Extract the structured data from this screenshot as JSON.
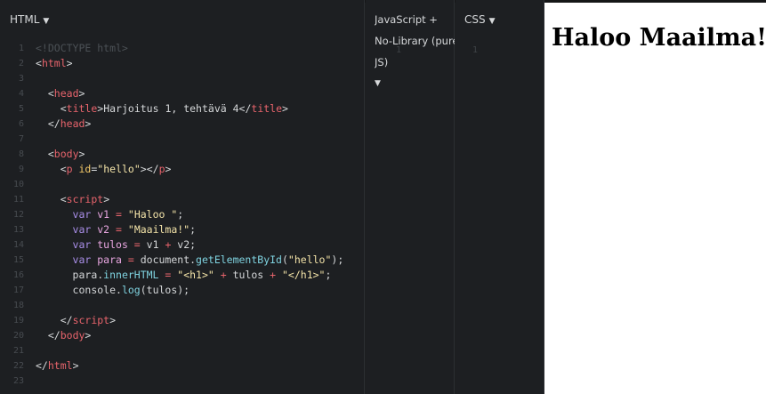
{
  "panels": {
    "html": {
      "label": "HTML",
      "caret": "▼"
    },
    "js": {
      "line1": "JavaScript +",
      "line2": "No-Library (pure",
      "line3": "JS)",
      "caret": "▼",
      "line_number": "1"
    },
    "css": {
      "label": "CSS",
      "caret": "▼",
      "line_number": "1"
    }
  },
  "code_lines": [
    {
      "n": "1"
    },
    {
      "n": "2"
    },
    {
      "n": "3"
    },
    {
      "n": "4"
    },
    {
      "n": "5"
    },
    {
      "n": "6"
    },
    {
      "n": "7"
    },
    {
      "n": "8"
    },
    {
      "n": "9"
    },
    {
      "n": "10"
    },
    {
      "n": "11"
    },
    {
      "n": "12"
    },
    {
      "n": "13"
    },
    {
      "n": "14"
    },
    {
      "n": "15"
    },
    {
      "n": "16"
    },
    {
      "n": "17"
    },
    {
      "n": "18"
    },
    {
      "n": "19"
    },
    {
      "n": "20"
    },
    {
      "n": "21"
    },
    {
      "n": "22"
    },
    {
      "n": "23"
    }
  ],
  "tokens": {
    "doctype": "<!DOCTYPE html>",
    "lt": "<",
    "gt": ">",
    "lt_slash": "</",
    "html": "html",
    "head": "head",
    "title": "title",
    "body": "body",
    "p": "p",
    "script": "script",
    "title_text": "Harjoitus 1, tehtävä 4",
    "id_attr": " id",
    "eq": "=",
    "hello_q": "\"hello\"",
    "var": "var",
    "v1": " v1",
    "v2": " v2",
    "tulos": " tulos",
    "para": " para",
    "eq_sp": " = ",
    "s_haloo": "\"Haloo \"",
    "s_maailma": "\"Maailma!\"",
    "semi": ";",
    "v1_expr": "v1",
    "plus": " + ",
    "v2_expr": "v2",
    "document": "document.",
    "getById": "getElementById",
    "paren_open": "(",
    "paren_close": ")",
    "para_obj": "para.",
    "innerHTML": "innerHTML",
    "s_h1": "\"<h1>\"",
    "tulos_expr": "tulos",
    "s_h1_close": "\"</h1>\"",
    "console": "console.",
    "log": "log",
    "tulos_arg": "(tulos);"
  },
  "result": {
    "heading": "Haloo Maailma!"
  }
}
